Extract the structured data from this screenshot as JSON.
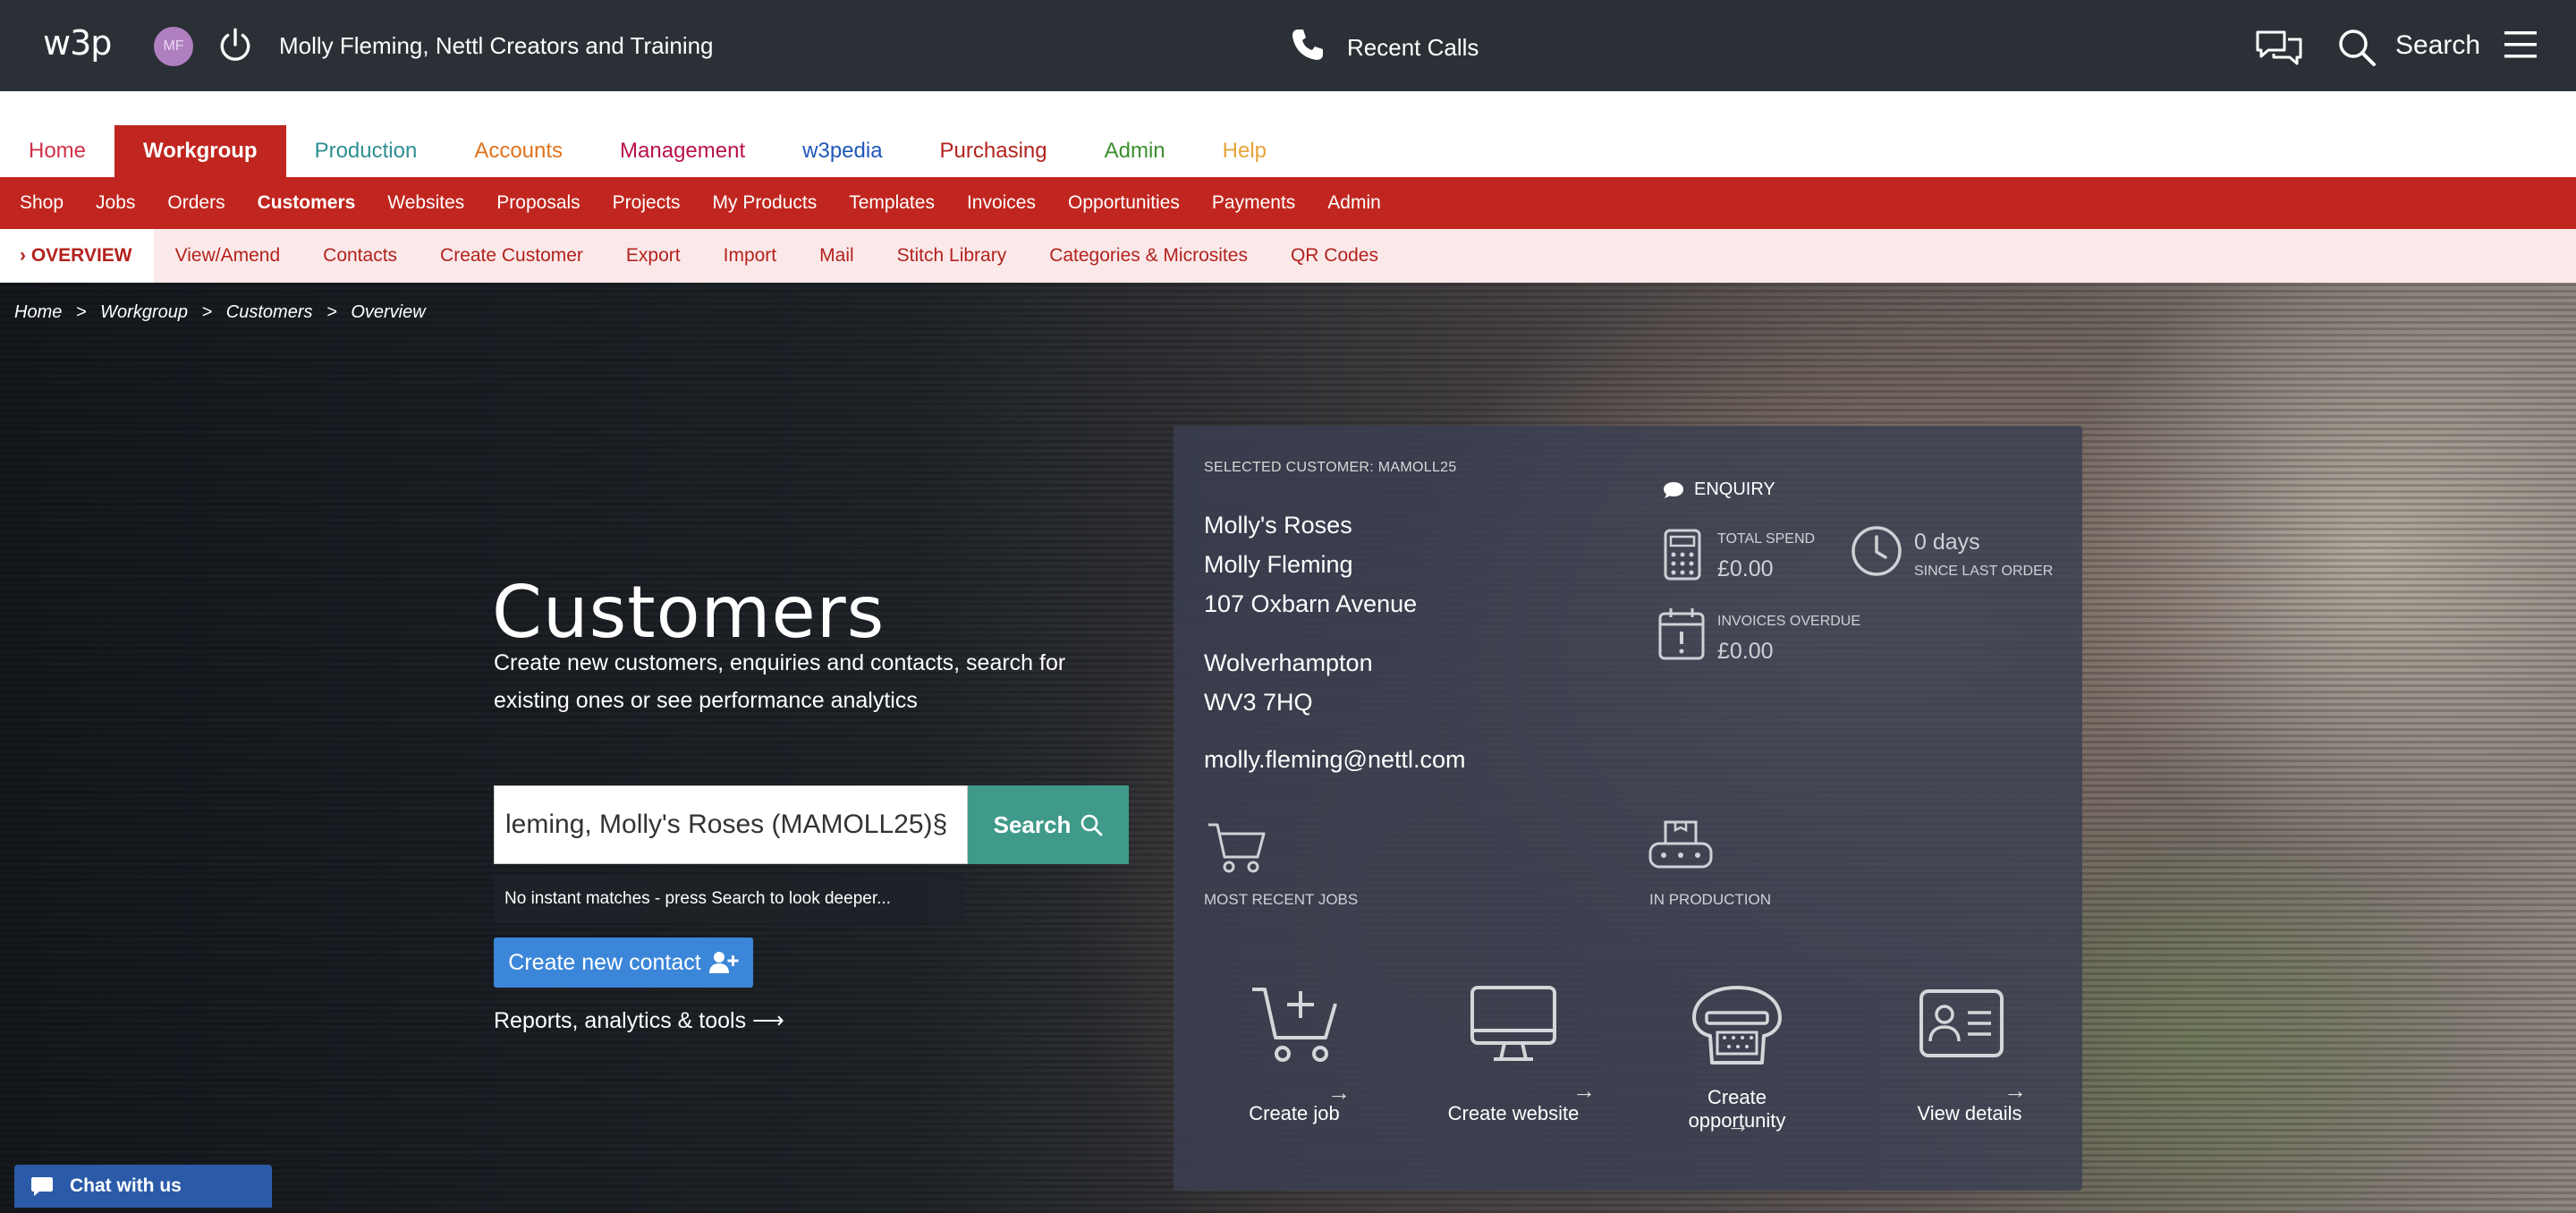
{
  "topbar": {
    "logo": "w3p",
    "avatar_initials": "MF",
    "username": "Molly Fleming, Nettl Creators and Training",
    "recent_calls": "Recent Calls",
    "search_label": "Search"
  },
  "main_nav": [
    {
      "label": "Home",
      "color": "#d0324a"
    },
    {
      "label": "Workgroup",
      "color": "#ffffff",
      "active": true
    },
    {
      "label": "Production",
      "color": "#2f8f91"
    },
    {
      "label": "Accounts",
      "color": "#e0731d"
    },
    {
      "label": "Management",
      "color": "#b8124a"
    },
    {
      "label": "w3pedia",
      "color": "#1f57b8"
    },
    {
      "label": "Purchasing",
      "color": "#b3221d"
    },
    {
      "label": "Admin",
      "color": "#3c8e2f"
    },
    {
      "label": "Help",
      "color": "#e6a53a"
    }
  ],
  "sub_nav": [
    "Shop",
    "Jobs",
    "Orders",
    "Customers",
    "Websites",
    "Proposals",
    "Projects",
    "My Products",
    "Templates",
    "Invoices",
    "Opportunities",
    "Payments",
    "Admin"
  ],
  "sub_nav_active": "Customers",
  "tert_nav": [
    "› OVERVIEW",
    "View/Amend",
    "Contacts",
    "Create Customer",
    "Export",
    "Import",
    "Mail",
    "Stitch Library",
    "Categories & Microsites",
    "QR Codes"
  ],
  "breadcrumb": [
    "Home",
    ">",
    "Workgroup",
    ">",
    "Customers",
    ">",
    "Overview"
  ],
  "hero": {
    "title": "Customers",
    "description": "Create new customers, enquiries and contacts, search for existing ones or see performance analytics",
    "search_value": "leming, Molly's Roses (MAMOLL25)§",
    "search_button": "Search",
    "no_match": "No instant matches - press Search to look deeper...",
    "new_contact": "Create new contact",
    "reports": "Reports, analytics & tools"
  },
  "card": {
    "selected": "SELECTED CUSTOMER: MAMOLL25",
    "address": [
      "Molly's Roses",
      "Molly Fleming",
      "107 Oxbarn Avenue",
      "Wolverhampton",
      "WV3 7HQ",
      "molly.fleming@nettl.com"
    ],
    "enquiry": "ENQUIRY",
    "total_spend_label": "TOTAL SPEND",
    "total_spend_value": "£0.00",
    "days_value": "0 days",
    "days_label": "SINCE LAST ORDER",
    "invoices_label": "INVOICES OVERDUE",
    "invoices_value": "£0.00",
    "most_recent_jobs": "MOST RECENT JOBS",
    "in_production": "IN PRODUCTION",
    "actions": [
      "Create job",
      "Create website",
      "Create opportunity",
      "View details"
    ]
  },
  "chat_widget": "Chat with us",
  "colors": {
    "topbar": "#2b3036",
    "brand_red": "#c0261f",
    "teal": "#3f9a8a",
    "blue": "#3b86d8"
  }
}
